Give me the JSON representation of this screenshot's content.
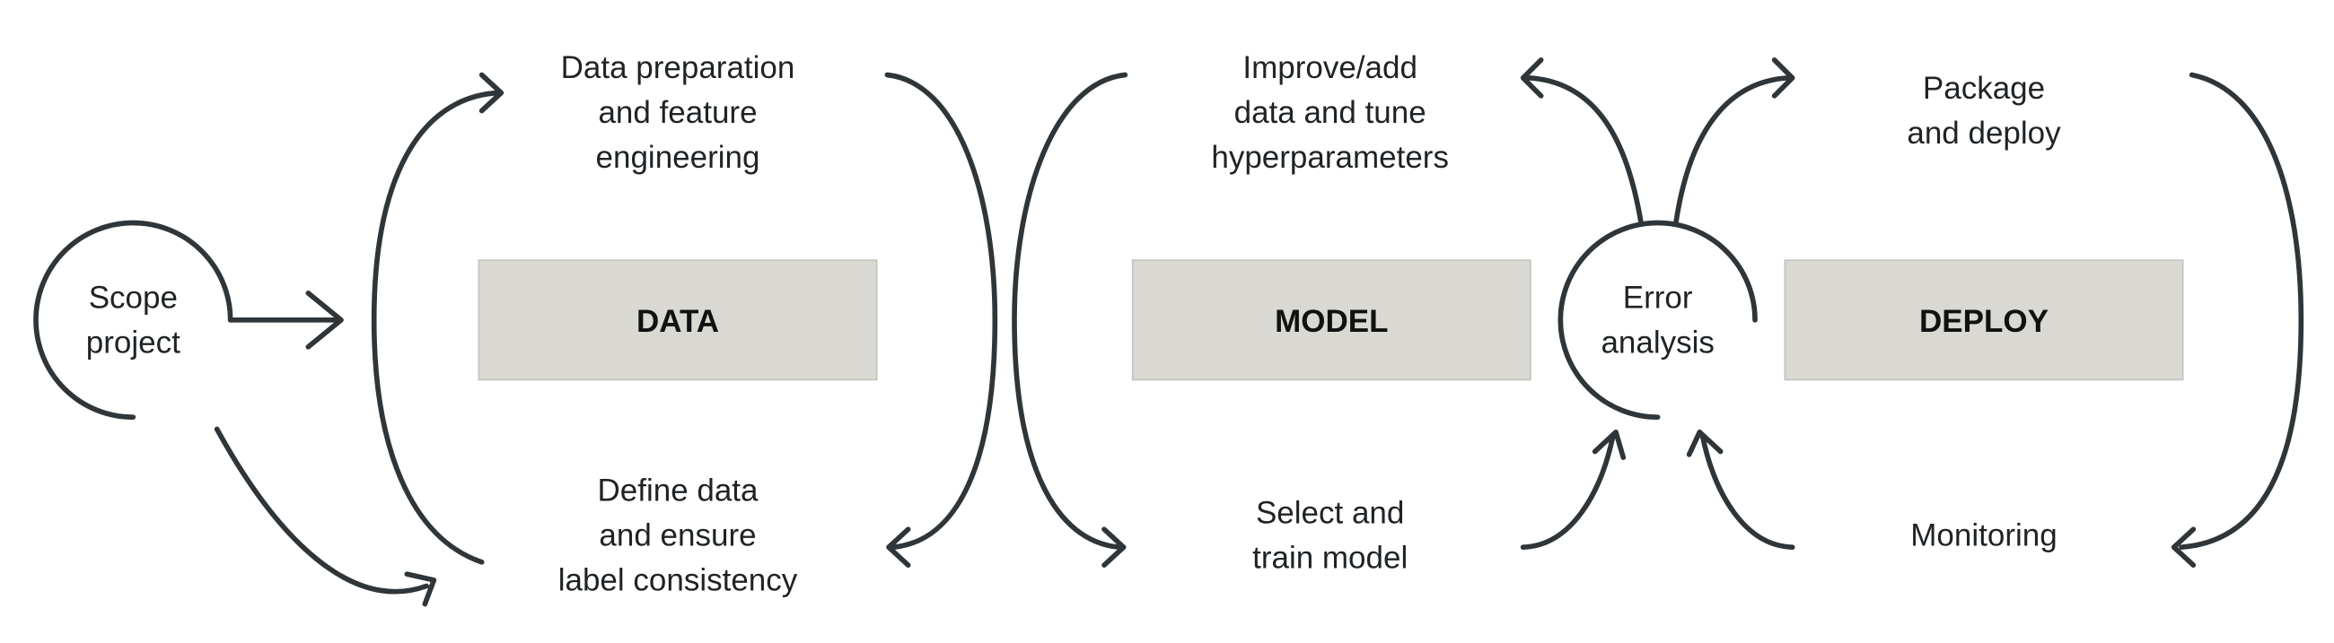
{
  "colors": {
    "stroke": "#2f3538",
    "box_fill": "#d9d8d3",
    "text": "#1f2326"
  },
  "scope": {
    "lines": [
      "Scope",
      "project"
    ]
  },
  "data_stage": {
    "box_label": "DATA",
    "top_lines": [
      "Data preparation",
      "and feature",
      "engineering"
    ],
    "bottom_lines": [
      "Define data",
      "and ensure",
      "label consistency"
    ]
  },
  "model_stage": {
    "box_label": "MODEL",
    "top_lines": [
      "Improve/add",
      "data and tune",
      "hyperparameters"
    ],
    "bottom_lines": [
      "Select and",
      "train model"
    ]
  },
  "error": {
    "lines": [
      "Error",
      "analysis"
    ]
  },
  "deploy_stage": {
    "box_label": "DEPLOY",
    "top_lines": [
      "Package",
      "and deploy"
    ],
    "bottom_lines": [
      "Monitoring"
    ]
  }
}
